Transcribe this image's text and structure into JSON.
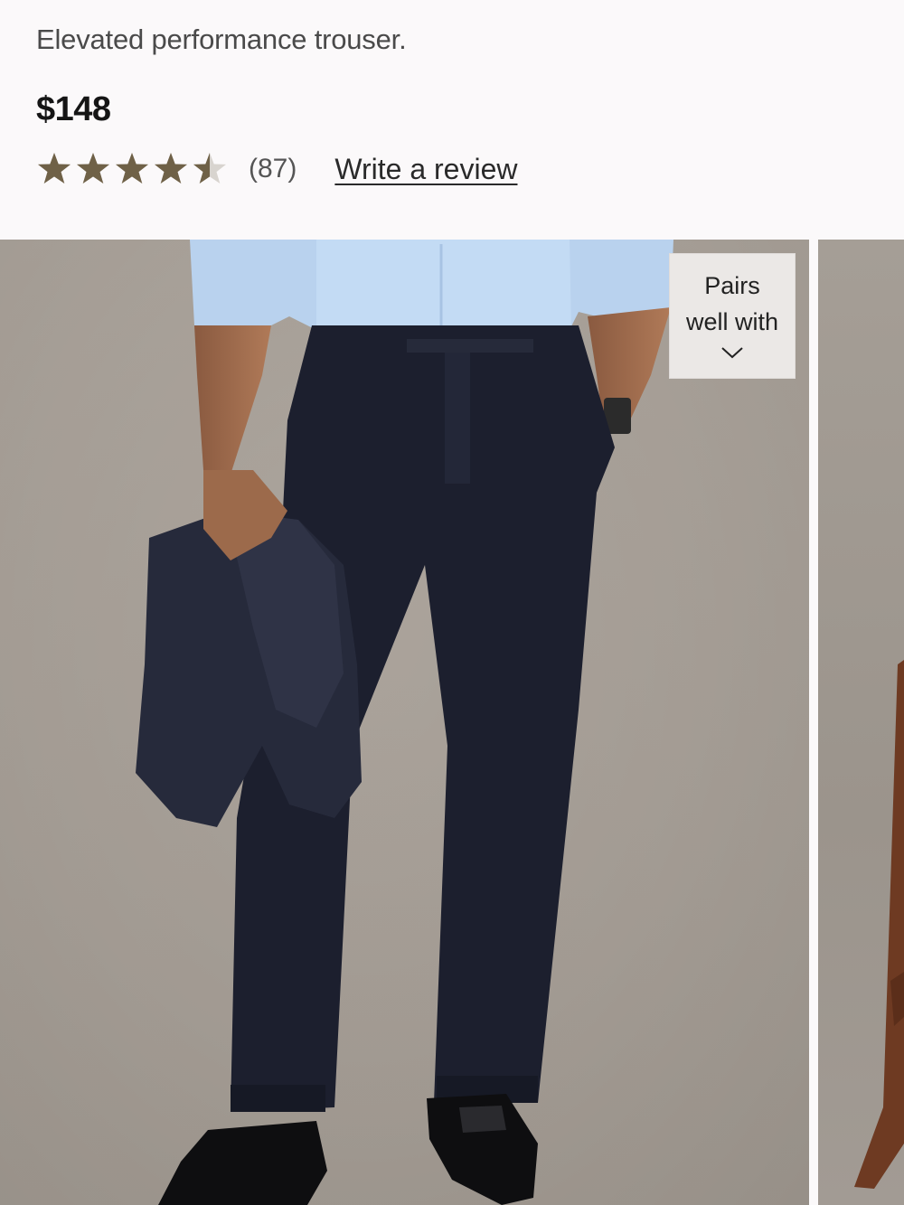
{
  "product": {
    "subtitle": "Elevated performance trouser.",
    "price": "$148",
    "rating": {
      "value": 4.5,
      "max": 5,
      "count_label": "(87)"
    },
    "write_review_label": "Write a review"
  },
  "gallery": {
    "pairs_button": {
      "line1": "Pairs",
      "line2": "well with"
    }
  },
  "colors": {
    "star_fill": "#6f6147",
    "star_empty": "#d8d4cf",
    "background": "#fbf9fa",
    "trouser": "#1c1f2e",
    "shirt": "#b9d2ee"
  },
  "icons": [
    "star-icon",
    "star-half-icon",
    "chevron-down-icon"
  ]
}
